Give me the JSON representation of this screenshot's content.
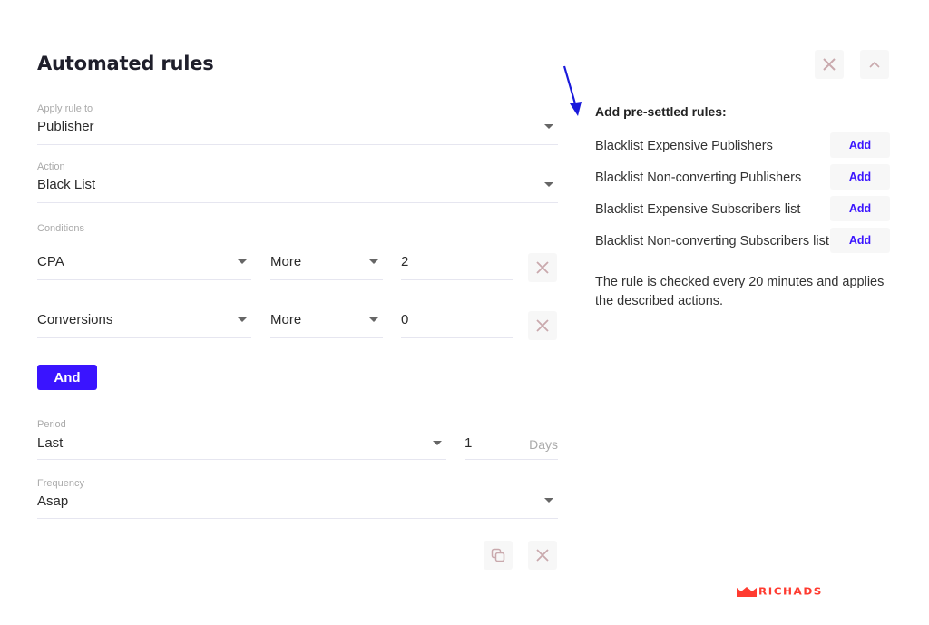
{
  "header": {
    "title": "Automated rules"
  },
  "form": {
    "apply_rule_to": {
      "label": "Apply rule to",
      "value": "Publisher"
    },
    "action": {
      "label": "Action",
      "value": "Black List"
    },
    "conditions": {
      "label": "Conditions",
      "rows": [
        {
          "metric": "CPA",
          "operator": "More",
          "value": "2"
        },
        {
          "metric": "Conversions",
          "operator": "More",
          "value": "0"
        }
      ],
      "and_label": "And"
    },
    "period": {
      "label": "Period",
      "value": "Last",
      "amount": "1",
      "unit": "Days"
    },
    "frequency": {
      "label": "Frequency",
      "value": "Asap"
    }
  },
  "presets": {
    "title": "Add pre-settled rules:",
    "items": [
      {
        "label": "Blacklist Expensive Publishers",
        "button": "Add"
      },
      {
        "label": "Blacklist Non-converting Publishers",
        "button": "Add"
      },
      {
        "label": "Blacklist Expensive Subscribers list",
        "button": "Add"
      },
      {
        "label": "Blacklist Non-converting Subscribers list",
        "button": "Add"
      }
    ],
    "note": "The rule is checked every 20 minutes and applies the described actions."
  },
  "brand": {
    "logo_text": "RICHADS",
    "color": "#ff3b30"
  },
  "colors": {
    "accent": "#3a14ff",
    "icon": "#c9a9ad",
    "annotation_arrow": "#1a1adb"
  }
}
